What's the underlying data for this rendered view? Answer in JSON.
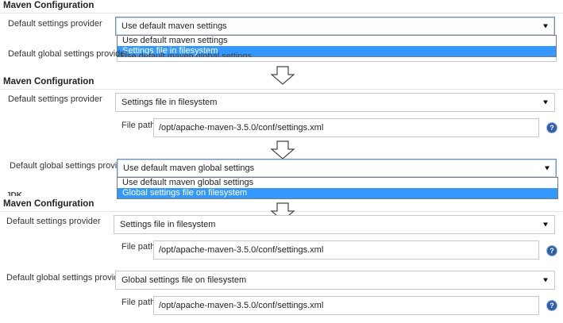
{
  "panel1": {
    "title": "Maven Configuration",
    "settings_label": "Default settings provider",
    "settings_selected": "Use default maven settings",
    "settings_options": [
      "Use default maven settings",
      "Settings file in filesystem"
    ],
    "global_label": "Default global settings provider",
    "global_peek": "Use default maven global settings"
  },
  "panel2": {
    "title": "Maven Configuration",
    "settings_label": "Default settings provider",
    "settings_selected": "Settings file in filesystem",
    "file_path_label": "File path",
    "file_path_value": "/opt/apache-maven-3.5.0/conf/settings.xml",
    "global_label": "Default global settings provider",
    "global_selected": "Use default maven global settings",
    "global_options": [
      "Use default maven global settings",
      "Global settings file on filesystem"
    ],
    "peek_label": "JDK"
  },
  "panel3": {
    "title": "Maven Configuration",
    "settings_label": "Default settings provider",
    "settings_selected": "Settings file in filesystem",
    "file_path_label": "File path",
    "file_path_value": "/opt/apache-maven-3.5.0/conf/settings.xml",
    "global_label": "Default global settings provider",
    "global_selected": "Global settings file on filesystem",
    "global_file_path_label": "File path",
    "global_file_path_value": "/opt/apache-maven-3.5.0/conf/settings.xml"
  },
  "help_glyph": "?",
  "icons": {
    "help": "question-circle-icon",
    "arrow": "down-arrow-icon",
    "caret": "caret-down-icon"
  }
}
